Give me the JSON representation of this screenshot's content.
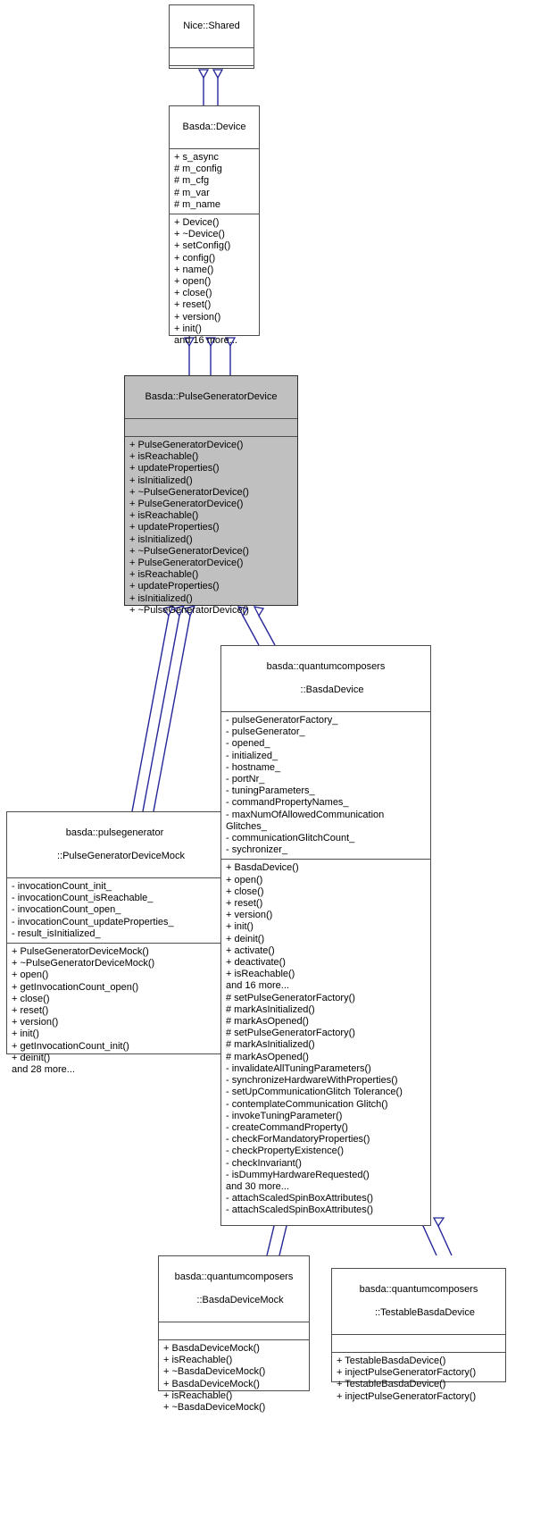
{
  "diagram": {
    "kind": "uml-class-inheritance-diagram",
    "edge_color": "#26269a",
    "highlight_fill": "#c0c0c0",
    "border_color": "#4d4d4d"
  },
  "classes": {
    "nice_shared": {
      "title": "Nice::Shared",
      "title_lines": [
        "Nice::Shared"
      ],
      "attributes": [],
      "methods": []
    },
    "basda_device": {
      "title": "Basda::Device",
      "title_lines": [
        "Basda::Device"
      ],
      "attributes": [
        "+ s_async",
        "# m_config",
        "# m_cfg",
        "# m_var",
        "# m_name"
      ],
      "methods": [
        "+ Device()",
        "+ ~Device()",
        "+ setConfig()",
        "+ config()",
        "+ name()",
        "+ open()",
        "+ close()",
        "+ reset()",
        "+ version()",
        "+ init()",
        "and 16 more..."
      ]
    },
    "pulse_generator_device": {
      "title": "Basda::PulseGeneratorDevice",
      "title_lines": [
        "Basda::PulseGeneratorDevice"
      ],
      "attributes": [],
      "methods": [
        "+ PulseGeneratorDevice()",
        "+ isReachable()",
        "+ updateProperties()",
        "+ isInitialized()",
        "+ ~PulseGeneratorDevice()",
        "+ PulseGeneratorDevice()",
        "+ isReachable()",
        "+ updateProperties()",
        "+ isInitialized()",
        "+ ~PulseGeneratorDevice()",
        "+ PulseGeneratorDevice()",
        "+ isReachable()",
        "+ updateProperties()",
        "+ isInitialized()",
        "+ ~PulseGeneratorDevice()"
      ]
    },
    "pulse_generator_device_mock": {
      "title": "basda::pulsegenerator::PulseGeneratorDeviceMock",
      "title_lines": [
        "basda::pulsegenerator",
        "::PulseGeneratorDeviceMock"
      ],
      "attributes": [
        "- invocationCount_init_",
        "- invocationCount_isReachable_",
        "- invocationCount_open_",
        "- invocationCount_updateProperties_",
        "- result_isInitialized_"
      ],
      "methods": [
        "+ PulseGeneratorDeviceMock()",
        "+ ~PulseGeneratorDeviceMock()",
        "+ open()",
        "+ getInvocationCount_open()",
        "+ close()",
        "+ reset()",
        "+ version()",
        "+ init()",
        "+ getInvocationCount_init()",
        "+ deinit()",
        "and 28 more..."
      ]
    },
    "basda_device_qc": {
      "title": "basda::quantumcomposers::BasdaDevice",
      "title_lines": [
        "basda::quantumcomposers",
        "::BasdaDevice"
      ],
      "attributes": [
        "- pulseGeneratorFactory_",
        "- pulseGenerator_",
        "- opened_",
        "- initialized_",
        "- hostname_",
        "- portNr_",
        "- tuningParameters_",
        "- commandPropertyNames_",
        "- maxNumOfAllowedCommunication Glitches_",
        "- communicationGlitchCount_",
        "- sychronizer_"
      ],
      "methods": [
        "+ BasdaDevice()",
        "+ open()",
        "+ close()",
        "+ reset()",
        "+ version()",
        "+ init()",
        "+ deinit()",
        "+ activate()",
        "+ deactivate()",
        "+ isReachable()",
        "and 16 more...",
        "# setPulseGeneratorFactory()",
        "# markAsInitialized()",
        "# markAsOpened()",
        "# setPulseGeneratorFactory()",
        "# markAsInitialized()",
        "# markAsOpened()",
        "- invalidateAllTuningParameters()",
        "- synchronizeHardwareWithProperties()",
        "- setUpCommunicationGlitch Tolerance()",
        "- contemplateCommunication Glitch()",
        "- invokeTuningParameter()",
        "- createCommandProperty()",
        "- checkForMandatoryProperties()",
        "- checkPropertyExistence()",
        "- checkInvariant()",
        "- isDummyHardwareRequested()",
        "and 30 more...",
        "- attachScaledSpinBoxAttributes()",
        "- attachScaledSpinBoxAttributes()"
      ]
    },
    "basda_device_mock": {
      "title": "basda::quantumcomposers::BasdaDeviceMock",
      "title_lines": [
        "basda::quantumcomposers",
        "::BasdaDeviceMock"
      ],
      "attributes": [],
      "methods": [
        "+ BasdaDeviceMock()",
        "+ isReachable()",
        "+ ~BasdaDeviceMock()",
        "+ BasdaDeviceMock()",
        "+ isReachable()",
        "+ ~BasdaDeviceMock()"
      ]
    },
    "testable_basda_device": {
      "title": "basda::quantumcomposers::TestableBasdaDevice",
      "title_lines": [
        "basda::quantumcomposers",
        "::TestableBasdaDevice"
      ],
      "attributes": [],
      "methods": [
        "+ TestableBasdaDevice()",
        "+ injectPulseGeneratorFactory()",
        "+ TestableBasdaDevice()",
        "+ injectPulseGeneratorFactory()"
      ]
    }
  }
}
